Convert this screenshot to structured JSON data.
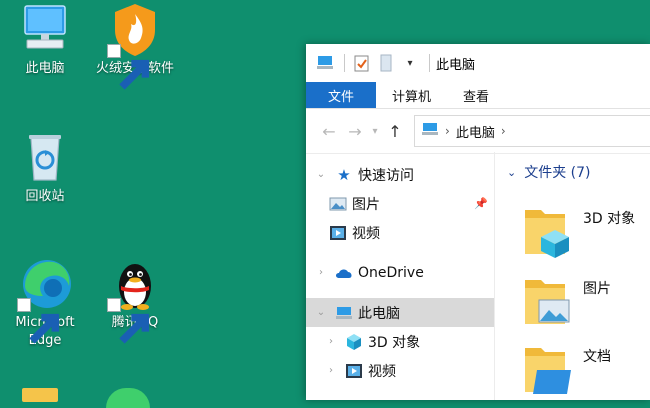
{
  "desktop": {
    "icons": [
      {
        "label": "此电脑",
        "icon": "computer-icon"
      },
      {
        "label": "火绒安全软件",
        "icon": "huorong-shield-icon"
      },
      {
        "label": "回收站",
        "icon": "recycle-bin-icon"
      },
      {
        "label": "Microsoft Edge",
        "icon": "edge-icon"
      },
      {
        "label": "腾讯QQ",
        "icon": "qq-penguin-icon"
      }
    ]
  },
  "explorer": {
    "title": "此电脑",
    "ribbon_tabs": [
      "文件",
      "计算机",
      "查看"
    ],
    "address": {
      "crumb": "此电脑"
    },
    "nav": {
      "quick_access": "快速访问",
      "pictures": "图片",
      "videos": "视频",
      "onedrive": "OneDrive",
      "this_pc": "此电脑",
      "objects3d": "3D 对象",
      "videos2": "视频"
    },
    "files": {
      "group": "文件夹 (7)",
      "folders": [
        "3D 对象",
        "图片",
        "文档"
      ]
    }
  },
  "colors": {
    "desktop_bg": "#0f8f6e",
    "ribbon_file": "#1a6fc9",
    "group_text": "#1c3f8e"
  }
}
